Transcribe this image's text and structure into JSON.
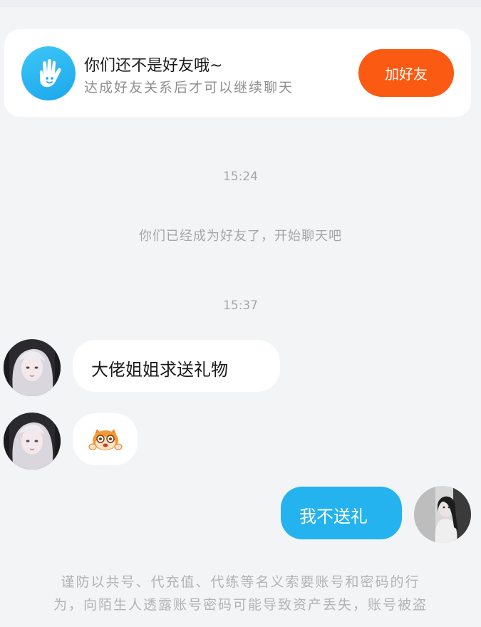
{
  "friend_banner": {
    "icon": "waving-hand-icon",
    "title": "你们还不是好友哦~",
    "subtitle": "达成好友关系后才可以继续聊天",
    "add_button_label": "加好友"
  },
  "chat": {
    "timestamps": [
      "15:24",
      "15:37"
    ],
    "system_message": "你们已经成为好友了，开始聊天吧",
    "messages": [
      {
        "from": "other",
        "type": "text",
        "text": "大佬姐姐求送礼物"
      },
      {
        "from": "other",
        "type": "sticker",
        "sticker": "cartoon-face-sticker"
      },
      {
        "from": "me",
        "type": "text",
        "text": "我不送礼"
      }
    ]
  },
  "footer_notice": {
    "line1": "谨防以共号、代充值、代练等名义索要账号和密码的行",
    "line2": "为，向陌生人透露账号密码可能导致资产丢失，账号被盗"
  },
  "colors": {
    "page_background": "#f3f4f6",
    "add_button": "#fb5a12",
    "outgoing_bubble": "#24b3ee",
    "banner_icon": "#1ba7ec"
  }
}
